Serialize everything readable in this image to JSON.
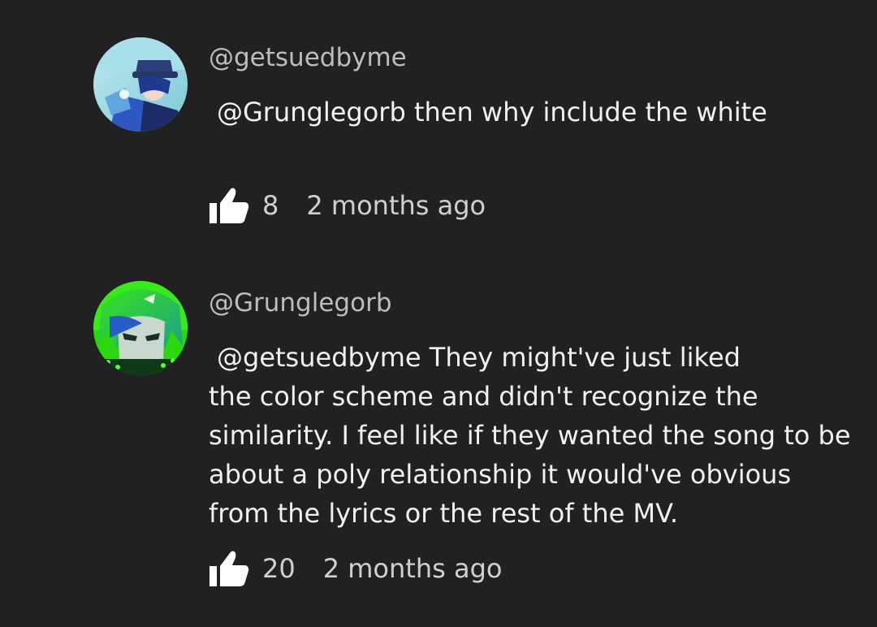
{
  "comments": [
    {
      "author": "@getsuedbyme",
      "mention": "@Grunglegorb",
      "text_first": " then why include the white",
      "text_rest": "",
      "likes": "8",
      "time": "2 months ago",
      "avatar": "avatar-blue-character"
    },
    {
      "author": "@Grunglegorb",
      "mention": "@getsuedbyme",
      "text_first": "  They might've just liked",
      "text_rest": "the color scheme and didn't recognize the similarity. I feel like if they wanted the song to be about a poly relationship it would've obvious from the lyrics or the rest of the MV.",
      "likes": "20",
      "time": "2 months ago",
      "avatar": "avatar-green-character"
    }
  ],
  "icons": {
    "like": "thumbs-up-icon"
  },
  "colors": {
    "background": "#212121",
    "text": "#f1f1f1",
    "secondary_text": "#bdbdbd",
    "icon": "#ffffff"
  }
}
